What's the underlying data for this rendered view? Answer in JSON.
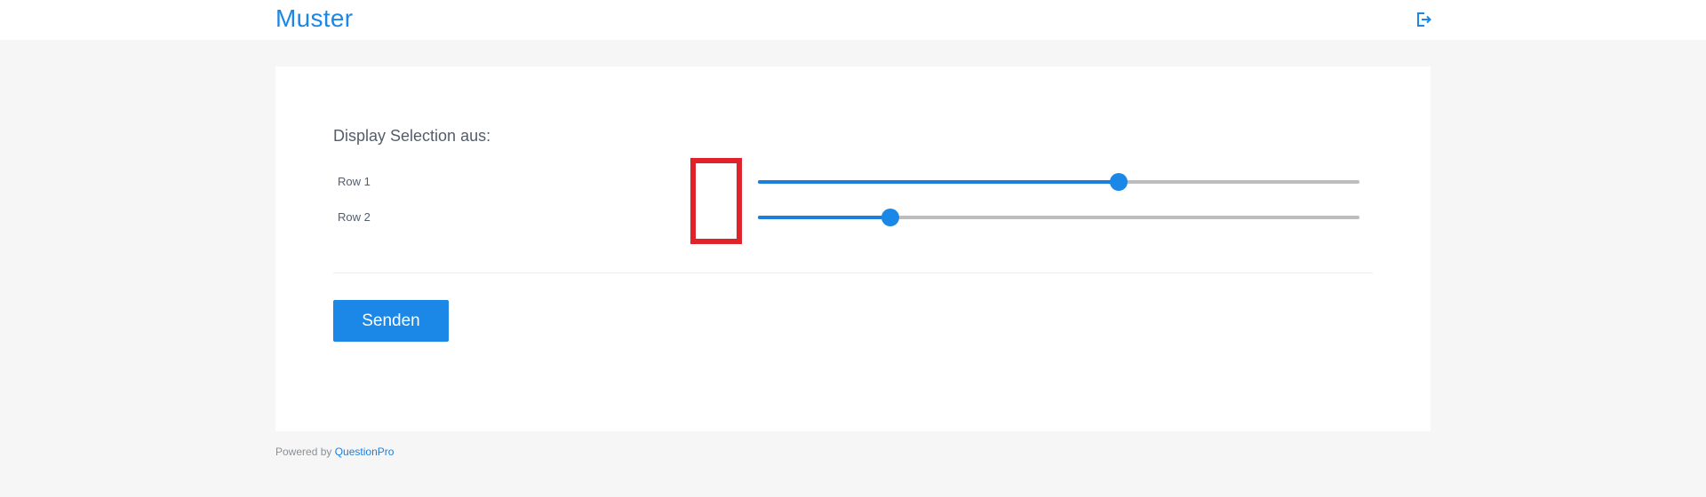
{
  "header": {
    "brand": "Muster",
    "logout_icon": "logout-icon"
  },
  "survey": {
    "question": "Display Selection aus:",
    "rows": [
      {
        "label": "Row 1",
        "value_percent": 60
      },
      {
        "label": "Row 2",
        "value_percent": 22
      }
    ],
    "submit_label": "Senden"
  },
  "footer": {
    "powered_by": "Powered by",
    "link_text": "QuestionPro"
  },
  "colors": {
    "accent": "#1b87e6",
    "highlight": "#e0232b",
    "track": "#bdbdbd",
    "background": "#f6f6f6"
  }
}
